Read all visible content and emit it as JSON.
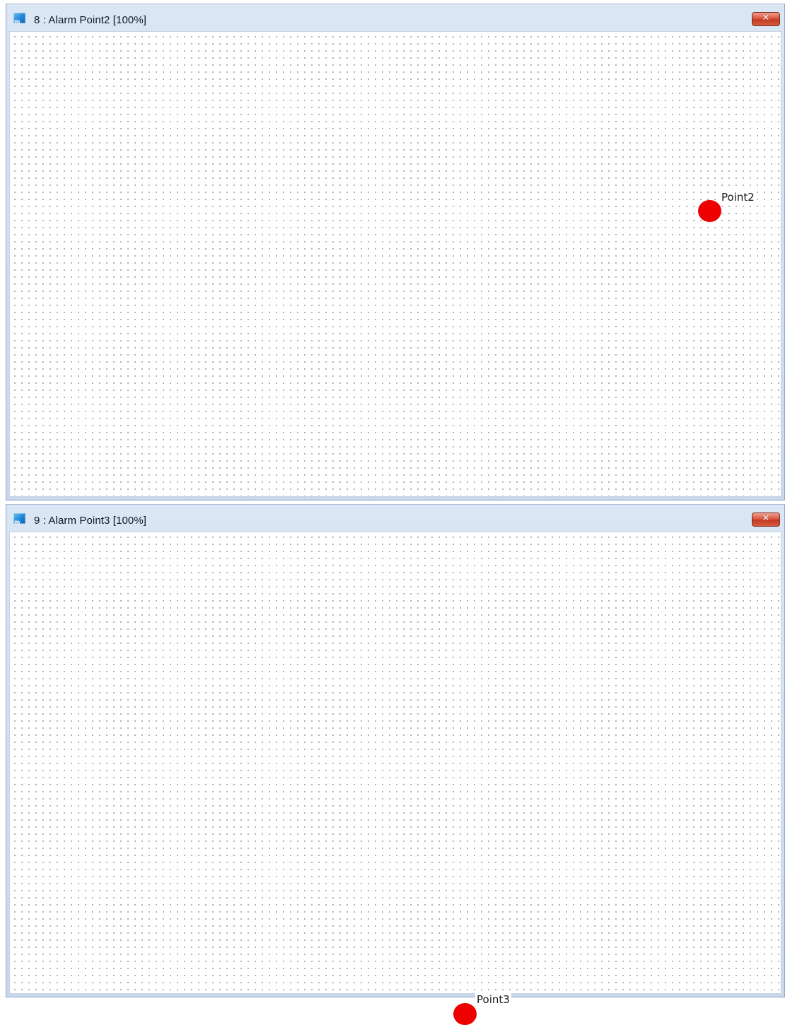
{
  "windows": [
    {
      "title": "8 : Alarm Point2 [100%]",
      "close_label": "✕",
      "points": [
        {
          "label": "Point2",
          "color": "#ee0000"
        }
      ]
    },
    {
      "title": "9 : Alarm Point3 [100%]",
      "close_label": "✕",
      "points": [
        {
          "label": "Point3",
          "color": "#ee0000"
        }
      ]
    }
  ],
  "icons": {
    "app": "app-logo-icon",
    "close": "close-icon"
  },
  "colors": {
    "titlebar": "#c9d8ec",
    "close_button": "#c23a22",
    "alarm_point": "#ee0000",
    "grid_dot": "#8a8f8a"
  }
}
